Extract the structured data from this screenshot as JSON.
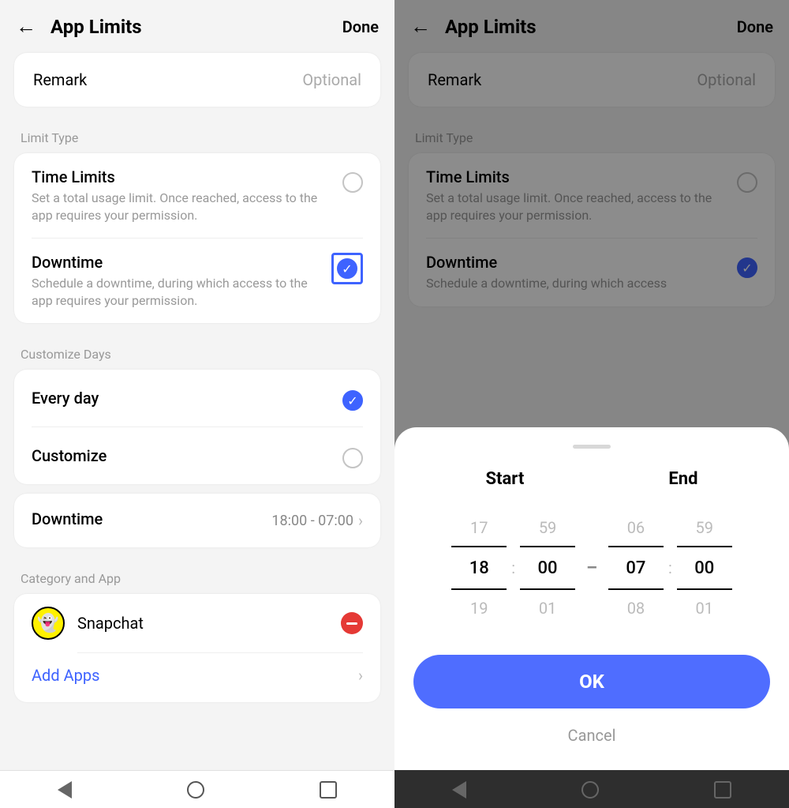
{
  "left": {
    "header": {
      "title": "App Limits",
      "done": "Done"
    },
    "remark": {
      "label": "Remark",
      "placeholder": "Optional"
    },
    "sections": {
      "limit_type_label": "Limit Type",
      "customize_days_label": "Customize Days",
      "category_app_label": "Category and App"
    },
    "limit_type": {
      "time_limits": {
        "title": "Time Limits",
        "desc": "Set a total usage limit. Once reached, access to the app requires your permission."
      },
      "downtime": {
        "title": "Downtime",
        "desc": "Schedule a downtime, during which access to the app requires your permission."
      }
    },
    "days": {
      "every": "Every day",
      "customize": "Customize"
    },
    "downtime_row": {
      "label": "Downtime",
      "value": "18:00 - 07:00"
    },
    "apps": {
      "snapchat": "Snapchat",
      "add": "Add Apps"
    }
  },
  "right": {
    "header": {
      "title": "App Limits",
      "done": "Done"
    },
    "remark": {
      "label": "Remark",
      "placeholder": "Optional"
    },
    "sections": {
      "limit_type_label": "Limit Type"
    },
    "limit_type": {
      "time_limits": {
        "title": "Time Limits",
        "desc": "Set a total usage limit. Once reached, access to the app requires your permission."
      },
      "downtime": {
        "title": "Downtime",
        "desc": "Schedule a downtime, during which access"
      }
    },
    "sheet": {
      "start_label": "Start",
      "end_label": "End",
      "start": {
        "h_prev": "17",
        "h": "18",
        "h_next": "19",
        "m_prev": "59",
        "m": "00",
        "m_next": "01"
      },
      "end": {
        "h_prev": "06",
        "h": "07",
        "h_next": "08",
        "m_prev": "59",
        "m": "00",
        "m_next": "01"
      },
      "ok": "OK",
      "cancel": "Cancel"
    }
  }
}
